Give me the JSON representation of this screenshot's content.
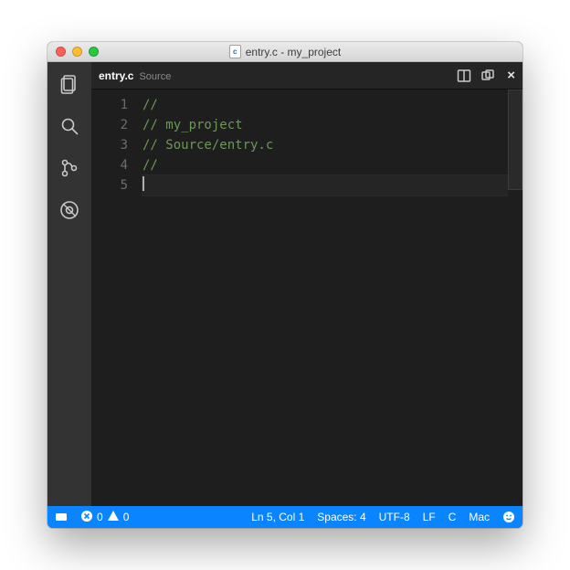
{
  "window": {
    "title": "entry.c - my_project"
  },
  "tab": {
    "filename": "entry.c",
    "folder": "Source"
  },
  "code": {
    "lines": [
      {
        "n": "1",
        "text": "//"
      },
      {
        "n": "2",
        "text": "// my_project"
      },
      {
        "n": "3",
        "text": "// Source/entry.c"
      },
      {
        "n": "4",
        "text": "//"
      },
      {
        "n": "5",
        "text": ""
      }
    ]
  },
  "status": {
    "errors": "0",
    "warnings": "0",
    "position": "Ln 5, Col 1",
    "indent": "Spaces: 4",
    "encoding": "UTF-8",
    "eol": "LF",
    "language": "C",
    "os": "Mac"
  }
}
